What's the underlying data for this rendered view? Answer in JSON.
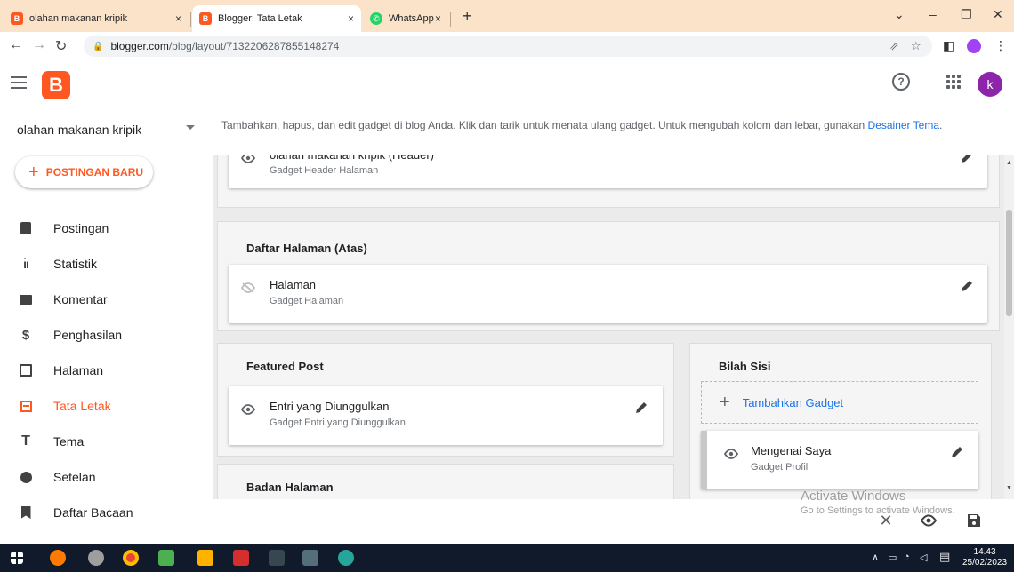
{
  "browser": {
    "tabs": [
      {
        "title": "olahan makanan kripik",
        "close": "×"
      },
      {
        "title": "Blogger: Tata Letak",
        "close": "×"
      },
      {
        "title": "WhatsApp",
        "close": "×"
      }
    ],
    "new_tab": "+",
    "url_host": "blogger.com",
    "url_path": "/blog/layout/7132206287855148274",
    "window_controls": [
      "⌄",
      "–",
      "❐",
      "✕"
    ]
  },
  "app": {
    "blog_name": "olahan makanan kripik",
    "new_post_label": "POSTINGAN BARU",
    "avatar_letter": "k",
    "help_glyph": "?"
  },
  "sidebar": {
    "items": [
      {
        "label": "Postingan",
        "icon": "posts-icon"
      },
      {
        "label": "Statistik",
        "icon": "stats-icon"
      },
      {
        "label": "Komentar",
        "icon": "comments-icon"
      },
      {
        "label": "Penghasilan",
        "icon": "earnings-icon"
      },
      {
        "label": "Halaman",
        "icon": "pages-icon"
      },
      {
        "label": "Tata Letak",
        "icon": "layout-icon",
        "active": true
      },
      {
        "label": "Tema",
        "icon": "theme-icon"
      },
      {
        "label": "Setelan",
        "icon": "settings-icon"
      },
      {
        "label": "Daftar Bacaan",
        "icon": "reading-list-icon"
      }
    ]
  },
  "main": {
    "intro_text": "Tambahkan, hapus, dan edit gadget di blog Anda. Klik dan tarik untuk menata ulang gadget. Untuk mengubah kolom dan lebar, gunakan",
    "intro_link": "Desainer Tema",
    "intro_period": ".",
    "header_gadget": {
      "name": "olahan makanan kripik (Header)",
      "type": "Gadget Header Halaman"
    },
    "page_list_section": {
      "title": "Daftar Halaman (Atas)",
      "gadget": {
        "name": "Halaman",
        "type": "Gadget Halaman",
        "visible": false
      }
    },
    "featured_section": {
      "title": "Featured Post",
      "gadget": {
        "name": "Entri yang Diunggulkan",
        "type": "Gadget Entri yang Diunggulkan"
      }
    },
    "body_section": {
      "title": "Badan Halaman"
    },
    "sidebar_section": {
      "title": "Bilah Sisi",
      "add_label": "Tambahkan Gadget",
      "gadget": {
        "name": "Mengenai Saya",
        "type": "Gadget Profil"
      }
    }
  },
  "watermark": {
    "line1": "Activate Windows",
    "line2": "Go to Settings to activate Windows."
  },
  "taskbar": {
    "time": "14.43",
    "date": "25/02/2023"
  },
  "colors": {
    "accent": "#ff5722",
    "link": "#1a73e8",
    "tabstrip": "#fbe3c9",
    "taskbar": "#101a2a"
  }
}
